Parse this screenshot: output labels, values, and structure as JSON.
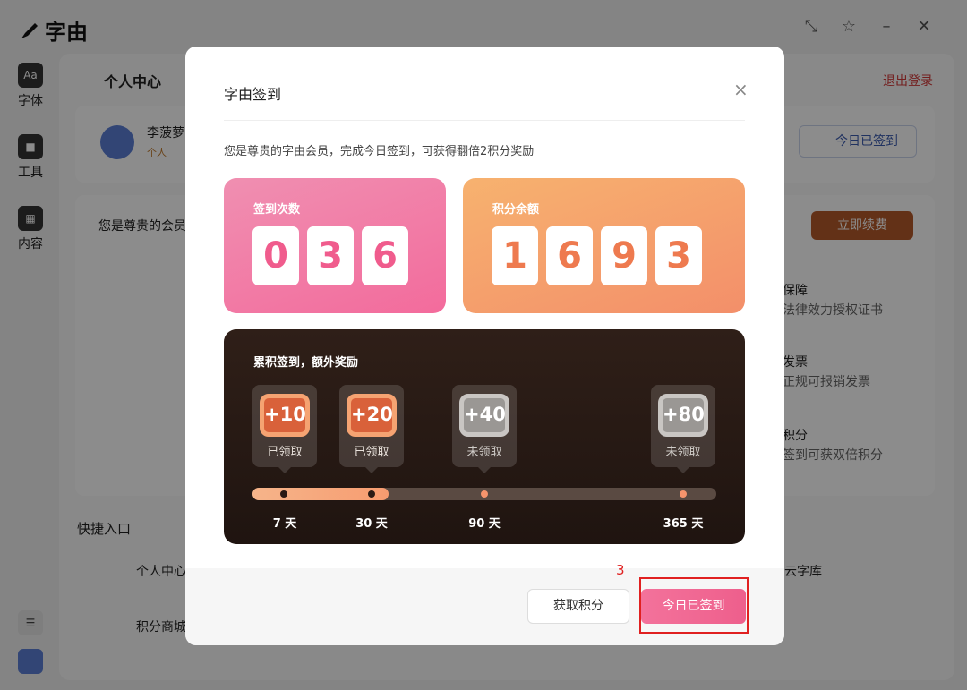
{
  "app": {
    "title": "字由"
  },
  "sidebar": {
    "items": [
      {
        "icon": "Aa",
        "label": "字体"
      },
      {
        "label": "工具"
      },
      {
        "label": "内容"
      }
    ]
  },
  "background": {
    "section_title": "个人中心",
    "logout": "退出登录",
    "user_name": "李菠萝",
    "user_tag": "个人",
    "today_signed": "今日已签到",
    "member_text": "您是尊贵的会员",
    "renew": "立即续费",
    "features": [
      {
        "title": "保障",
        "desc": "法律效力授权证书"
      },
      {
        "title": "发票",
        "desc": "正规可报销发票"
      },
      {
        "title": "积分",
        "desc": "签到可获双倍积分"
      }
    ],
    "quick_title": "快捷入口",
    "quick": [
      {
        "label": "个人中心"
      },
      {
        "label": "云字库"
      },
      {
        "label": "积分商城"
      }
    ]
  },
  "modal": {
    "title": "字由签到",
    "close": "×",
    "description": "您是尊贵的字由会员，完成今日签到，可获得翻倍2积分奖励",
    "sign_count": {
      "label": "签到次数",
      "digits": [
        "0",
        "3",
        "6"
      ]
    },
    "points": {
      "label": "积分余额",
      "digits": [
        "1",
        "6",
        "9",
        "3"
      ]
    },
    "reward": {
      "title": "累积签到，额外奖励",
      "milestones": [
        {
          "bonus": "+10",
          "status": "已领取",
          "day": "7 天",
          "claimed": true
        },
        {
          "bonus": "+20",
          "status": "已领取",
          "day": "30 天",
          "claimed": true
        },
        {
          "bonus": "+40",
          "status": "未领取",
          "day": "90 天",
          "claimed": false
        },
        {
          "bonus": "+80",
          "status": "未领取",
          "day": "365 天",
          "claimed": false
        }
      ],
      "progress_days": 30
    },
    "buttons": {
      "get_points": "获取积分",
      "signed_today": "今日已签到"
    }
  },
  "annotation": {
    "label": "3",
    "color": "#e02020"
  },
  "colors": {
    "pink": "#f36b9c",
    "orange": "#f38f6a",
    "reward_bg": "#2a1a14",
    "accent": "#ee5f8c"
  }
}
